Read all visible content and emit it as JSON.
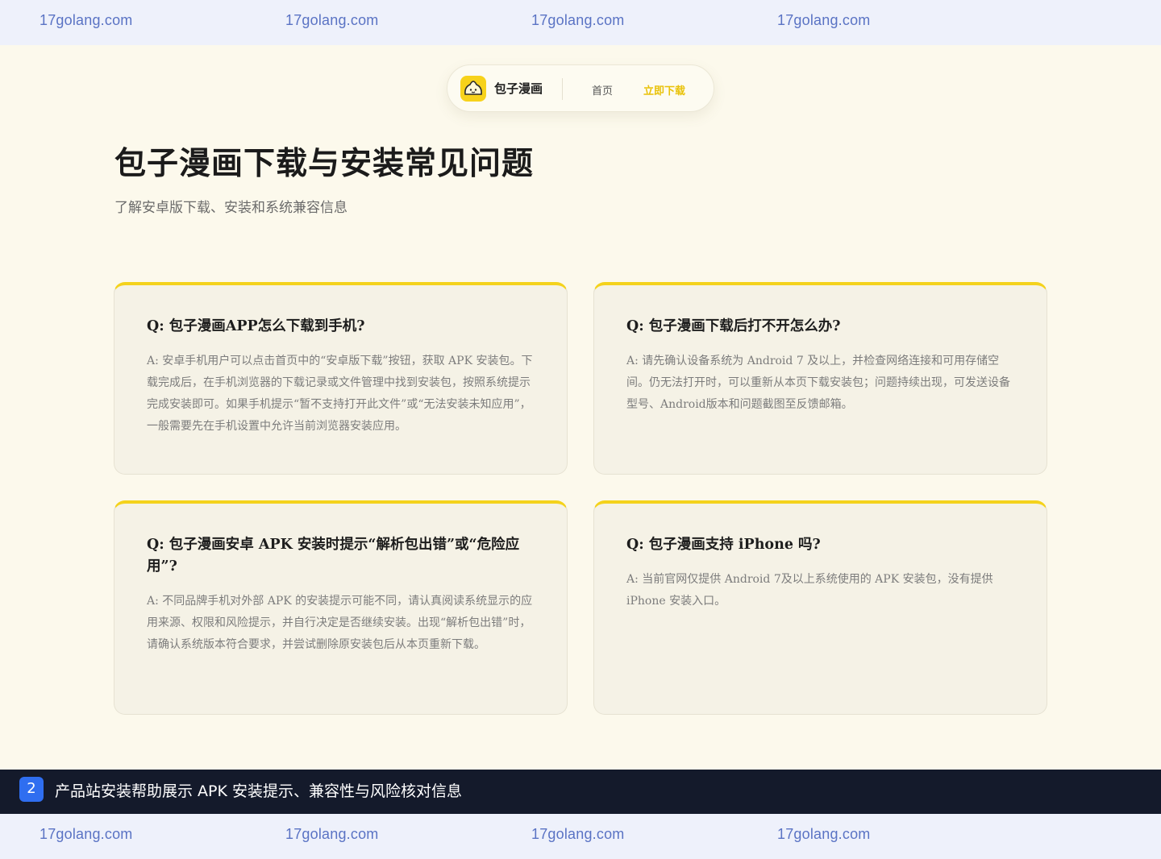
{
  "watermark": {
    "text": "17golang.com"
  },
  "nav": {
    "brand": "包子漫画",
    "home": "首页",
    "download": "立即下载",
    "logo_icon": "bun-face-icon",
    "accent_color": "#f4d21c"
  },
  "header": {
    "title": "包子漫画下载与安装常见问题",
    "subtitle": "了解安卓版下载、安装和系统兼容信息"
  },
  "faq": [
    {
      "question": "Q: 包子漫画APP怎么下载到手机?",
      "answer": "A: 安卓手机用户可以点击首页中的“安卓版下载”按钮，获取 APK 安装包。下载完成后，在手机浏览器的下载记录或文件管理中找到安装包，按照系统提示完成安装即可。如果手机提示“暂不支持打开此文件”或“无法安装未知应用”，一般需要先在手机设置中允许当前浏览器安装应用。"
    },
    {
      "question": "Q: 包子漫画下载后打不开怎么办?",
      "answer": "A: 请先确认设备系统为 Android 7 及以上，并检查网络连接和可用存储空间。仍无法打开时，可以重新从本页下载安装包；问题持续出现，可发送设备型号、Android版本和问题截图至反馈邮箱。"
    },
    {
      "question": "Q: 包子漫画安卓 APK 安装时提示“解析包出错”或“危险应用”?",
      "answer": "A: 不同品牌手机对外部 APK 的安装提示可能不同，请认真阅读系统显示的应用来源、权限和风险提示，并自行决定是否继续安装。出现“解析包出错”时，请确认系统版本符合要求，并尝试删除原安装包后从本页重新下载。"
    },
    {
      "question": "Q: 包子漫画支持 iPhone 吗?",
      "answer": "A: 当前官网仅提供 Android 7及以上系统使用的 APK 安装包，没有提供 iPhone 安装入口。"
    }
  ],
  "caption": {
    "badge": "2",
    "text": "产品站安装帮助展示 APK 安装提示、兼容性与风险核对信息",
    "badge_color": "#2f6ef0"
  }
}
